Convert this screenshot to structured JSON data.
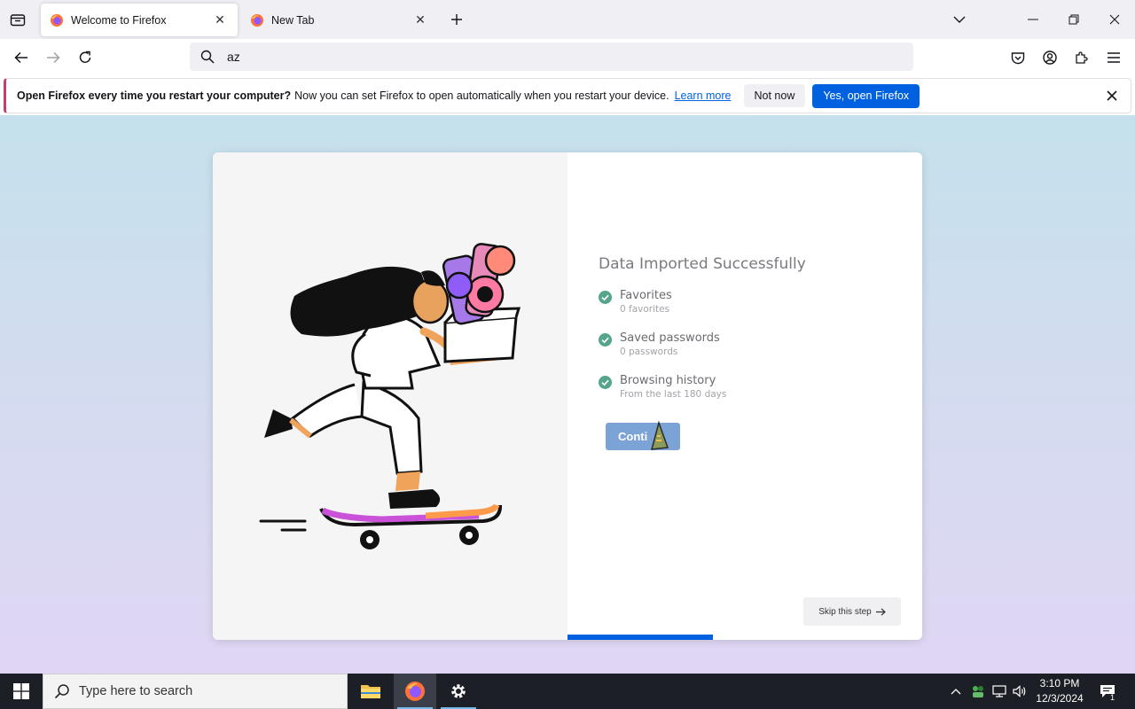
{
  "tabs": [
    {
      "title": "Welcome to Firefox",
      "active": true
    },
    {
      "title": "New Tab",
      "active": false
    }
  ],
  "url_bar": {
    "value": "az"
  },
  "notification": {
    "bold_text": "Open Firefox every time you restart your computer?",
    "message": "Now you can set Firefox to open automatically when you restart your device.",
    "learn_more": "Learn more",
    "not_now": "Not now",
    "yes_button": "Yes, open Firefox"
  },
  "import": {
    "title": "Data Imported Successfully",
    "items": [
      {
        "label": "Favorites",
        "detail": "0 favorites"
      },
      {
        "label": "Saved passwords",
        "detail": "0 passwords"
      },
      {
        "label": "Browsing history",
        "detail": "From the last 180 days"
      }
    ],
    "continue_label": "Conti",
    "skip_label": "Skip this step",
    "progress_fraction": 0.41
  },
  "taskbar": {
    "search_placeholder": "Type here to search",
    "time": "3:10 PM",
    "date": "12/3/2024",
    "notification_count": "1"
  },
  "colors": {
    "accent": "#0061e0",
    "check": "#54a58a",
    "continue_button": "#7ba3d6",
    "notification_stripe": "#c4416f"
  }
}
